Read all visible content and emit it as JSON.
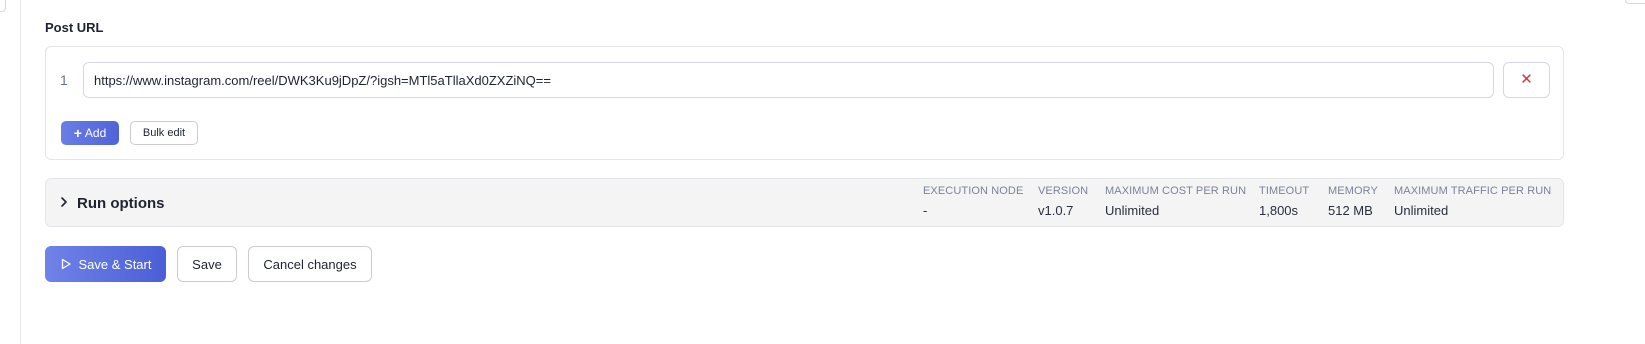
{
  "post_url": {
    "label": "Post URL",
    "rows": [
      {
        "number": "1",
        "value": "https://www.instagram.com/reel/DWK3Ku9jDpZ/?igsh=MTl5aTllaXd0ZXZiNQ==",
        "remove_icon": "close-icon"
      }
    ],
    "add_label": "Add",
    "add_icon": "plus-icon",
    "bulk_edit_label": "Bulk edit"
  },
  "run_options": {
    "title": "Run options",
    "toggle_icon": "chevron-right-icon",
    "meta": {
      "execution_node": {
        "label": "EXECUTION NODE",
        "value": "-"
      },
      "version": {
        "label": "VERSION",
        "value": "v1.0.7"
      },
      "max_cost": {
        "label": "MAXIMUM COST PER RUN",
        "value": "Unlimited"
      },
      "timeout": {
        "label": "TIMEOUT",
        "value": "1,800s"
      },
      "memory": {
        "label": "MEMORY",
        "value": "512 MB"
      },
      "max_traffic": {
        "label": "MAXIMUM TRAFFIC PER RUN",
        "value": "Unlimited"
      }
    }
  },
  "actions": {
    "save_start_label": "Save & Start",
    "save_start_icon": "play-icon",
    "save_label": "Save",
    "cancel_label": "Cancel changes"
  },
  "colors": {
    "primary_gradient_start": "#7083e8",
    "primary_gradient_end": "#4a5fd6",
    "danger": "#d8343a",
    "panel_background": "#f4f4f5",
    "border": "#e3e5ea"
  }
}
